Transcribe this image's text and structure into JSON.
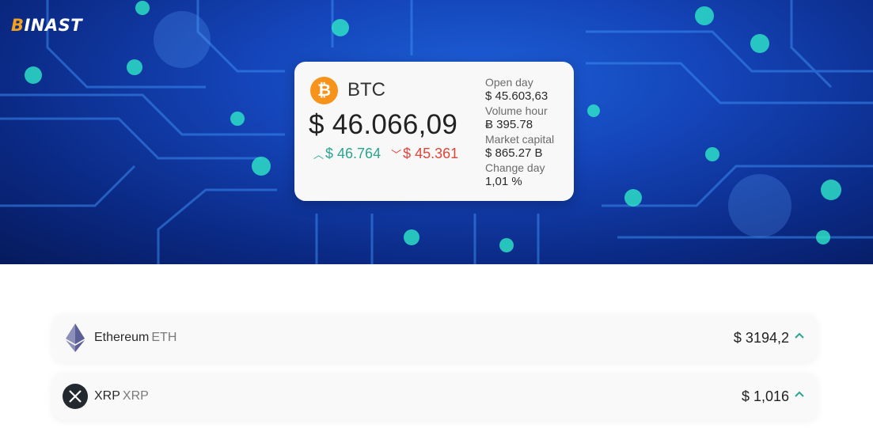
{
  "brand": {
    "logo_text_lead": "B",
    "logo_text_rest": "INAST"
  },
  "featured": {
    "symbol": "BTC",
    "icon": "bitcoin-icon",
    "icon_color": "#f7931a",
    "price": "$ 46.066,09",
    "high": "$ 46.764",
    "low": "$ 45.361",
    "stats": [
      {
        "label": "Open day",
        "value": "$ 45.603,63"
      },
      {
        "label": "Volume hour",
        "value": "Ƀ 395.78"
      },
      {
        "label": "Market capital",
        "value": "$ 865.27 B"
      },
      {
        "label": "Change day",
        "value": "1,01 %"
      }
    ]
  },
  "coins": [
    {
      "name": "Ethereum",
      "symbol": "ETH",
      "price": "$ 3194,2",
      "icon": "ethereum-icon",
      "trend": "up"
    },
    {
      "name": "XRP",
      "symbol": "XRP",
      "price": "$ 1,016",
      "icon": "xrp-icon",
      "trend": "up"
    }
  ],
  "colors": {
    "up": "#2aa58f",
    "down": "#e0453a",
    "accent": "#f2a11f"
  }
}
